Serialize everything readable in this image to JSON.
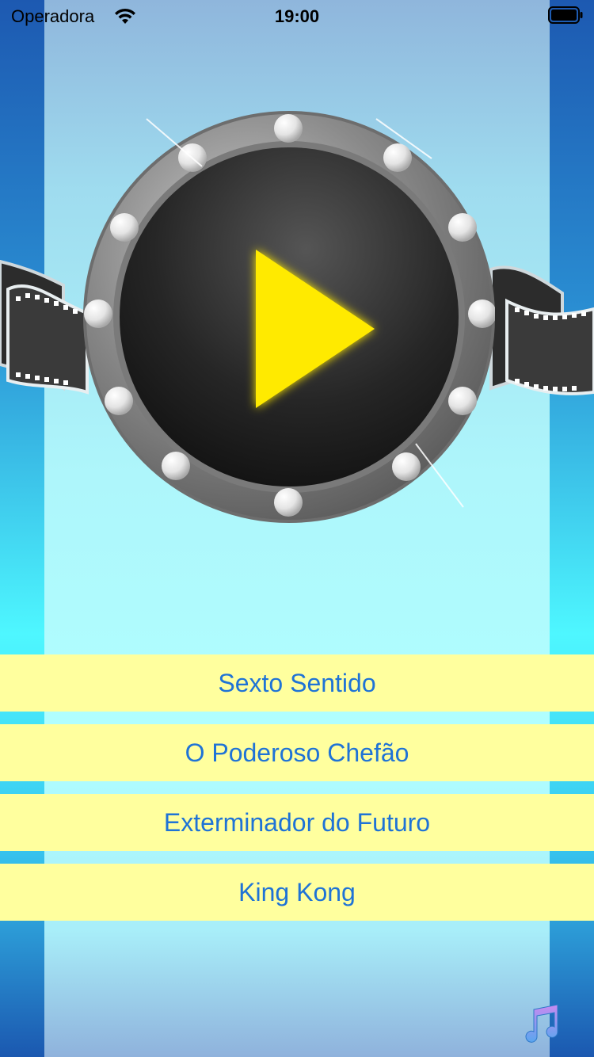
{
  "status_bar": {
    "carrier": "Operadora",
    "time": "19:00"
  },
  "icons": {
    "wifi": "wifi-icon",
    "battery": "battery-icon",
    "play": "play-icon",
    "film_strip": "film-strip-icon",
    "music": "music-note-icon"
  },
  "colors": {
    "button_bg": "#ffff9e",
    "button_text": "#1f73d6",
    "play_triangle": "#ffea00"
  },
  "movies": [
    {
      "label": "Sexto Sentido"
    },
    {
      "label": "O Poderoso Chefão"
    },
    {
      "label": "Exterminador do Futuro"
    },
    {
      "label": "King Kong"
    }
  ]
}
